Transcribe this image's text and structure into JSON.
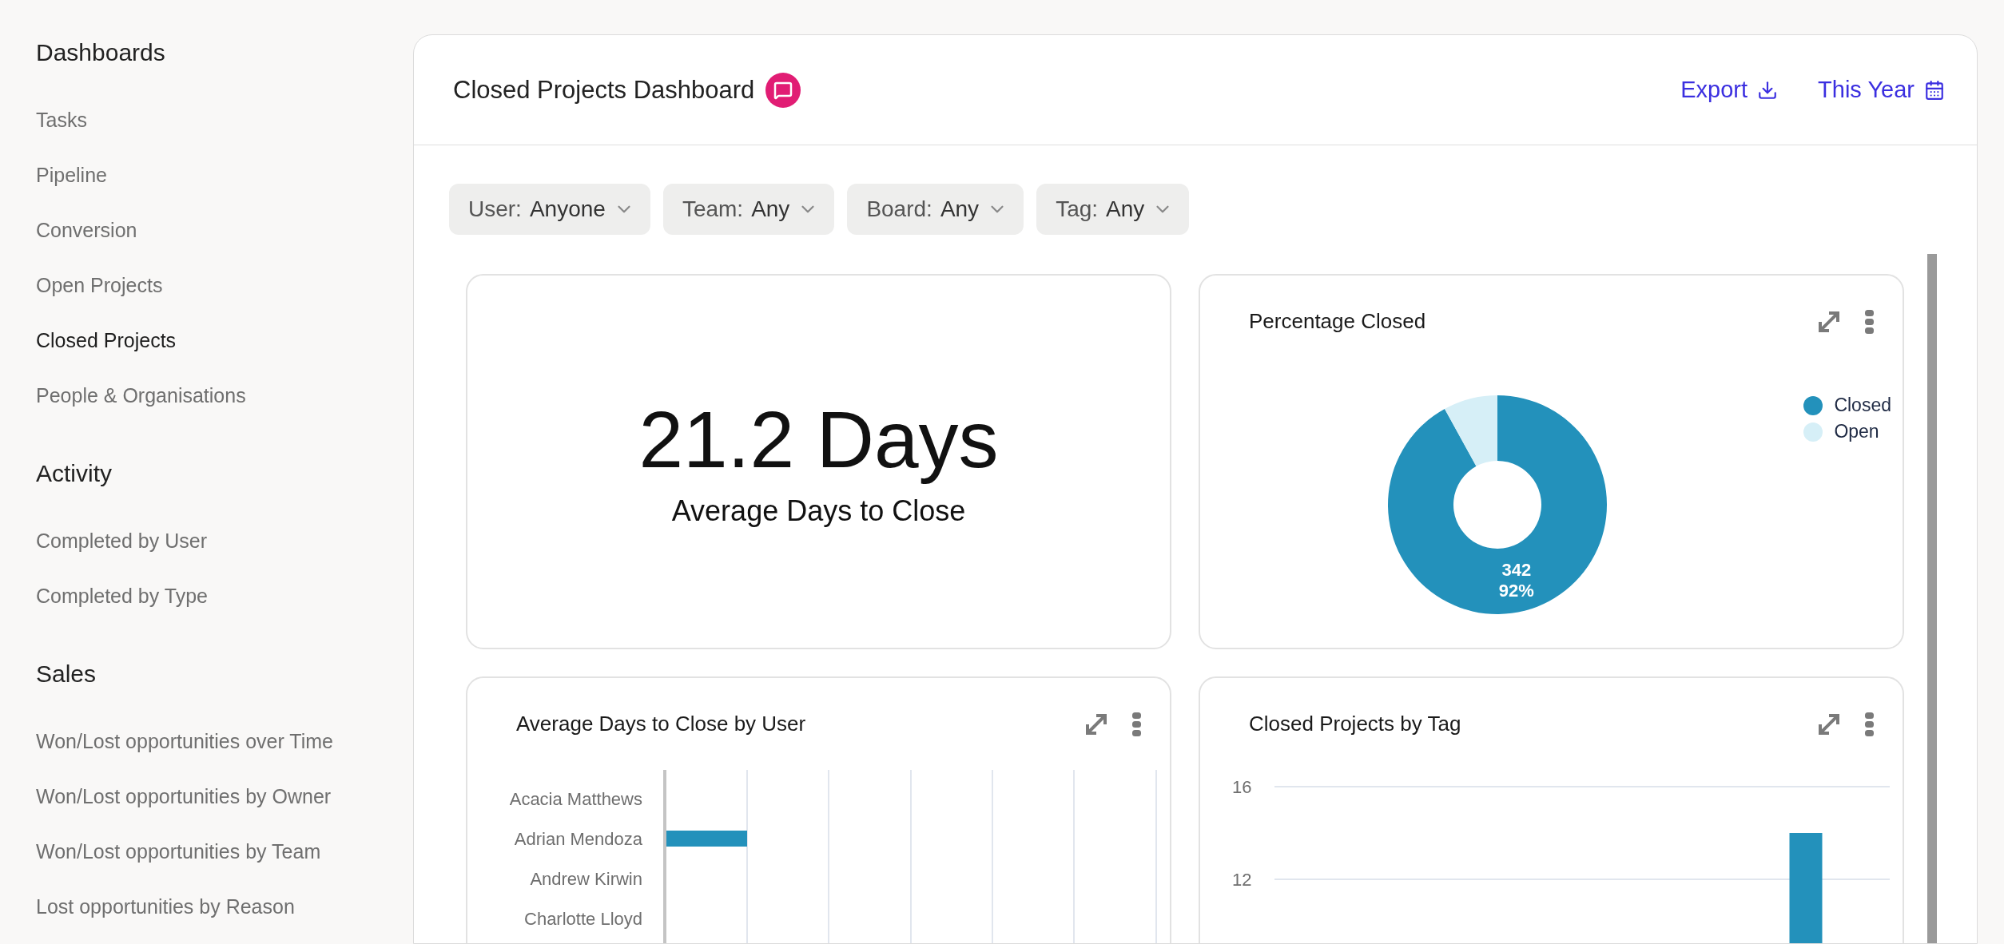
{
  "sidebar": {
    "sections": [
      {
        "heading": "Dashboards",
        "items": [
          {
            "label": "Tasks",
            "selected": false
          },
          {
            "label": "Pipeline",
            "selected": false
          },
          {
            "label": "Conversion",
            "selected": false
          },
          {
            "label": "Open Projects",
            "selected": false
          },
          {
            "label": "Closed Projects",
            "selected": true
          },
          {
            "label": "People & Organisations",
            "selected": false
          }
        ]
      },
      {
        "heading": "Activity",
        "items": [
          {
            "label": "Completed by User",
            "selected": false
          },
          {
            "label": "Completed by Type",
            "selected": false
          }
        ]
      },
      {
        "heading": "Sales",
        "items": [
          {
            "label": "Won/Lost opportunities over Time",
            "selected": false
          },
          {
            "label": "Won/Lost opportunities by Owner",
            "selected": false
          },
          {
            "label": "Won/Lost opportunities by Team",
            "selected": false
          },
          {
            "label": "Lost opportunities by Reason",
            "selected": false
          }
        ]
      }
    ]
  },
  "header": {
    "title": "Closed Projects Dashboard",
    "actions": [
      {
        "label": "Export",
        "kind": "export"
      },
      {
        "label": "This Year",
        "kind": "period"
      }
    ]
  },
  "filters": [
    {
      "label": "User:",
      "value": "Anyone"
    },
    {
      "label": "Team:",
      "value": "Any"
    },
    {
      "label": "Board:",
      "value": "Any"
    },
    {
      "label": "Tag:",
      "value": "Any"
    }
  ],
  "stat_card": {
    "value": "21.2 Days",
    "caption": "Average Days to Close"
  },
  "percentage_card": {
    "title": "Percentage Closed",
    "slice_label": {
      "count": "342",
      "percent": "92%"
    },
    "chart_data": {
      "type": "donut",
      "categories": [
        "Closed",
        "Open"
      ],
      "values": [
        92,
        8
      ],
      "colors": [
        "#2391bb",
        "#d6eff7"
      ]
    }
  },
  "user_card": {
    "title": "Average Days to Close by User",
    "users": [
      "Acacia Matthews",
      "Adrian Mendoza",
      "Andrew Kirwin",
      "Charlotte Lloyd"
    ]
  },
  "tag_card": {
    "title": "Closed Projects by Tag",
    "chart_data": {
      "type": "bar",
      "ylim": [
        0,
        16
      ],
      "yticks": [
        12,
        16
      ],
      "values": [
        null,
        null,
        null,
        null,
        null,
        null,
        null,
        null,
        null,
        14,
        null
      ]
    }
  }
}
